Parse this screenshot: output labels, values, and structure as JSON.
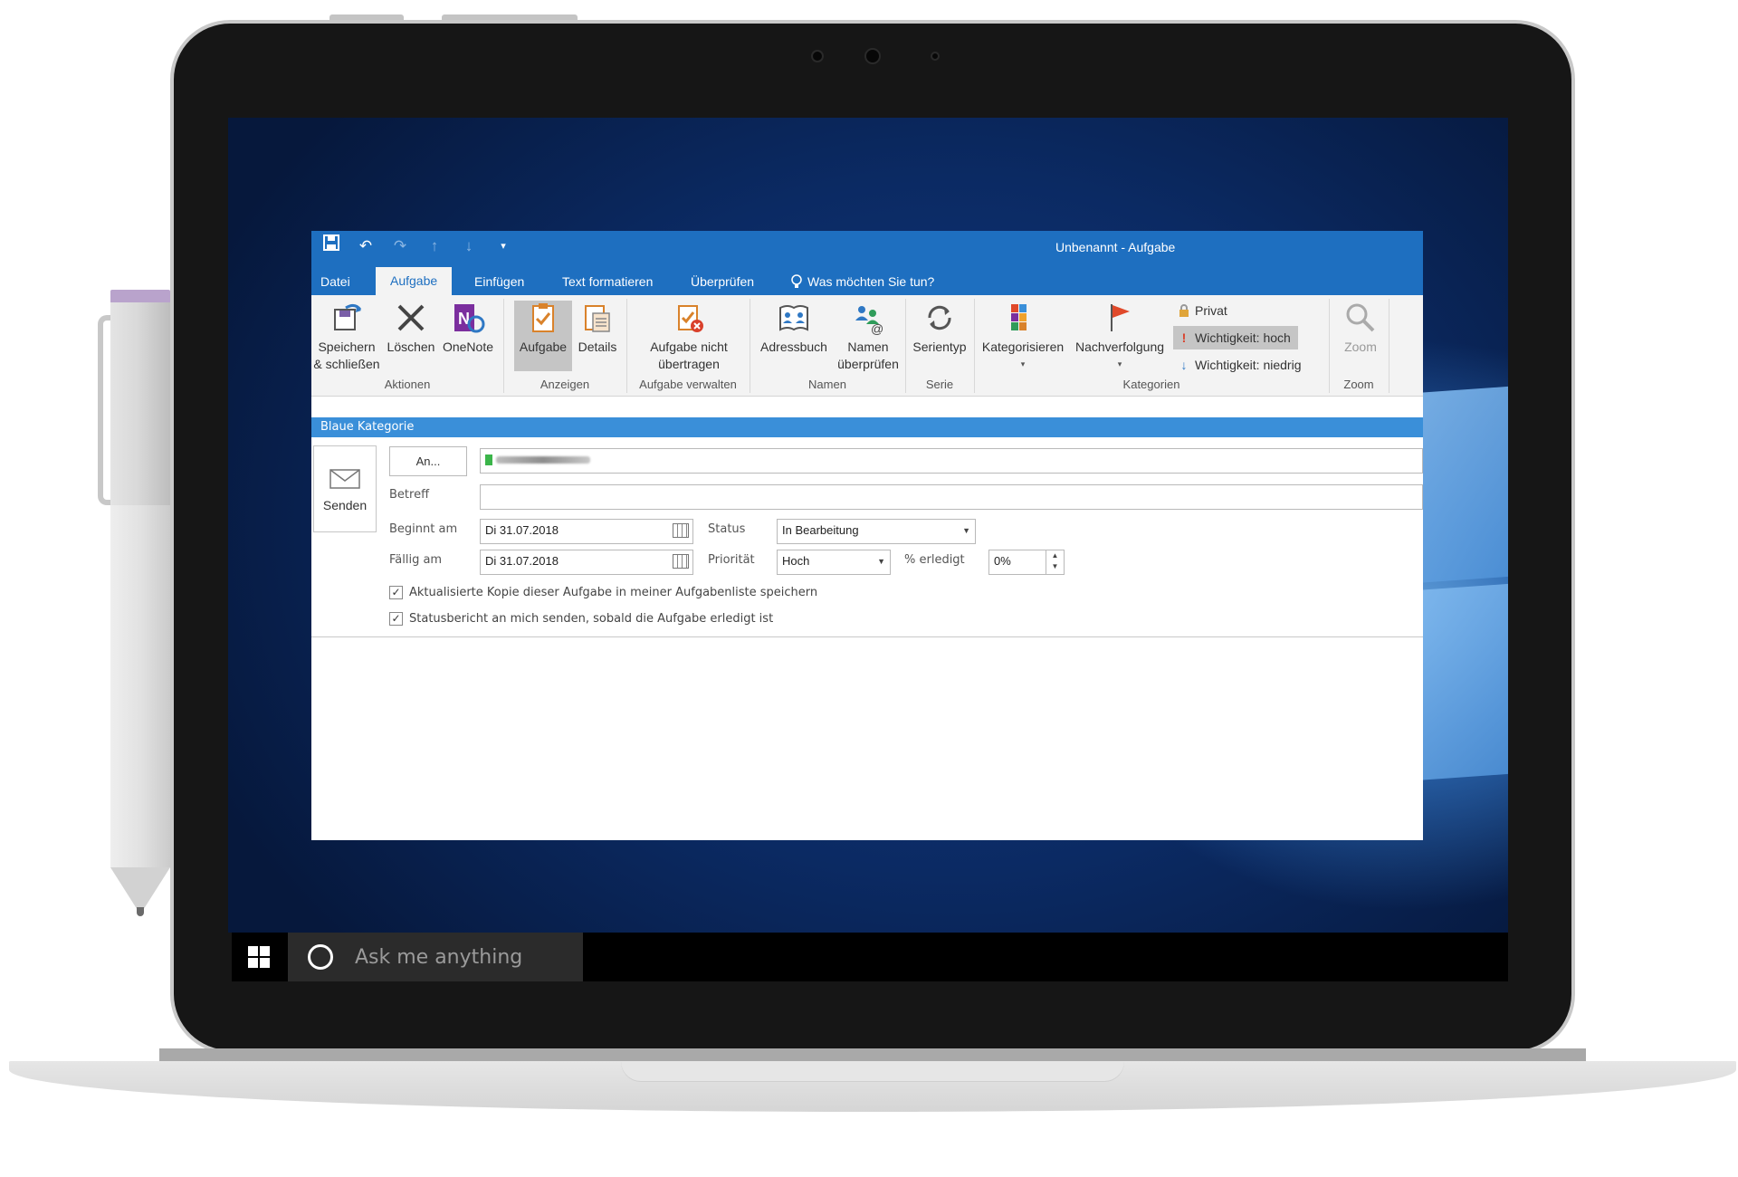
{
  "window": {
    "title": "Unbenannt - Aufgabe"
  },
  "tabs": [
    "Datei",
    "Aufgabe",
    "Einfügen",
    "Text formatieren",
    "Überprüfen"
  ],
  "active_tab": "Aufgabe",
  "tell_me": "Was möchten Sie tun?",
  "ribbon": {
    "groups": {
      "aktionen": "Aktionen",
      "anzeigen": "Anzeigen",
      "aufgabe_verwalten": "Aufgabe verwalten",
      "namen": "Namen",
      "serie": "Serie",
      "kategorien": "Kategorien",
      "zoom": "Zoom"
    },
    "buttons": {
      "speichern_1": "Speichern",
      "speichern_2": "& schließen",
      "loeschen": "Löschen",
      "onenote": "OneNote",
      "aufgabe": "Aufgabe",
      "details": "Details",
      "nicht_uebertragen_1": "Aufgabe nicht",
      "nicht_uebertragen_2": "übertragen",
      "adressbuch": "Adressbuch",
      "namen_1": "Namen",
      "namen_2": "überprüfen",
      "serientyp": "Serientyp",
      "kategorisieren": "Kategorisieren",
      "nachverfolgung": "Nachverfolgung",
      "privat": "Privat",
      "wichtig_hoch": "Wichtigkeit: hoch",
      "wichtig_niedrig": "Wichtigkeit: niedrig",
      "zoom": "Zoom"
    }
  },
  "category_bar": "Blaue Kategorie",
  "form": {
    "send": "Senden",
    "to_button": "An...",
    "subject_label": "Betreff",
    "subject_value": "",
    "start_label": "Beginnt am",
    "start_value": "Di 31.07.2018",
    "due_label": "Fällig am",
    "due_value": "Di 31.07.2018",
    "status_label": "Status",
    "status_value": "In Bearbeitung",
    "priority_label": "Priorität",
    "priority_value": "Hoch",
    "done_label": "% erledigt",
    "done_value": "0%",
    "check1": "Aktualisierte Kopie dieser Aufgabe in meiner Aufgabenliste speichern",
    "check2": "Statusbericht an mich senden, sobald die Aufgabe erledigt ist"
  },
  "taskbar": {
    "search_placeholder": "Ask me anything"
  },
  "icons": [
    "save-icon",
    "undo-icon",
    "redo-icon",
    "up-icon",
    "down-icon",
    "customize-icon",
    "lightbulb-icon",
    "lock-icon",
    "exclamation-icon",
    "arrow-down-icon",
    "windows-start-icon",
    "cortana-icon"
  ],
  "colors": {
    "title_blue": "#1e6fc0",
    "category_blue": "#3a8fd9",
    "ribbon_bg": "#f3f3f3"
  }
}
